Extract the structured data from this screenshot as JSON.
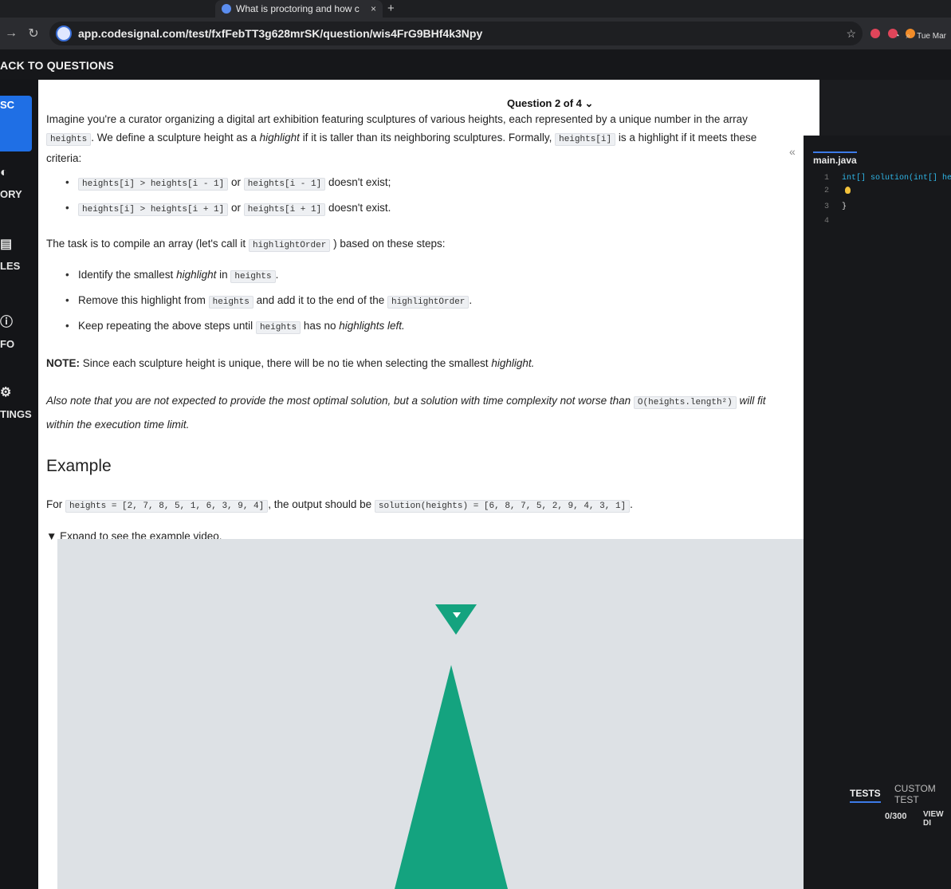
{
  "browser": {
    "tab_title": "What is proctoring and how c",
    "tab_close": "×",
    "new_tab": "+",
    "url": "app.codesignal.com/test/fxfFebTT3g628mrSK/question/wis4FrG9BHf4k3Npy",
    "clock": "Tue Mar"
  },
  "app": {
    "back_label": "ACK TO QUESTIONS",
    "question_nav": "Question 2 of 4 ⌄"
  },
  "sidebar": {
    "items": [
      {
        "label": "SC"
      },
      {
        "label": "ORY"
      },
      {
        "label": "LES"
      },
      {
        "label": "FO"
      },
      {
        "label": "TINGS"
      }
    ]
  },
  "problem": {
    "intro_1": "Imagine you're a curator organizing a digital art exhibition featuring sculptures of various heights, each represented by a unique number in the array",
    "intro_code_1": "heights",
    "intro_2": ". We define a sculpture height as a",
    "intro_italic": "highlight",
    "intro_3": "if it is taller than its neighboring sculptures. Formally,",
    "intro_code_2": "heights[i]",
    "intro_4": "is a highlight if it meets these criteria:",
    "criteria": [
      {
        "a": "heights[i] > heights[i - 1]",
        "or": "or",
        "b": "heights[i - 1]",
        "tail": "doesn't exist;"
      },
      {
        "a": "heights[i] > heights[i + 1]",
        "or": "or",
        "b": "heights[i + 1]",
        "tail": "doesn't exist."
      }
    ],
    "task_1": "The task is to compile an array (let's call it",
    "task_code": "highlightOrder",
    "task_2": ") based on these steps:",
    "steps": [
      {
        "pre": "Identify the smallest",
        "italic": "highlight",
        "mid": "in",
        "code": "heights",
        "post": ".",
        "code2": "",
        "post2": ""
      },
      {
        "pre": "Remove this highlight from",
        "italic": "",
        "mid": "",
        "code": "heights",
        "post": "and add it to the end of the",
        "code2": "highlightOrder",
        "post2": "."
      },
      {
        "pre": "Keep repeating the above steps until",
        "italic": "",
        "mid": "",
        "code": "heights",
        "post": "has no",
        "code2": "",
        "post2": "highlights left."
      }
    ],
    "note_bold": "NOTE:",
    "note_text": "Since each sculpture height is unique, there will be no tie when selecting the smallest",
    "note_italic": "highlight.",
    "also_1": "Also note that you are not expected to provide the most optimal solution, but a solution with time complexity not worse than",
    "also_code": "O(heights.length²)",
    "also_2": "will fit within the execution time limit.",
    "example_title": "Example",
    "example_for": "For",
    "example_input": "heights = [2, 7, 8, 5, 1, 6, 3, 9, 4]",
    "example_mid": ", the output should be",
    "example_output": "solution(heights) = [6, 8, 7, 5, 2, 9, 4, 3, 1]",
    "example_end": ".",
    "expand_label": "▼ Expand to see the example video."
  },
  "editor": {
    "file_tab": "main.java",
    "lines": [
      {
        "n": "1",
        "code": "int[] solution(int[] hei"
      },
      {
        "n": "2",
        "code": ""
      },
      {
        "n": "3",
        "code": "}"
      },
      {
        "n": "4",
        "code": ""
      }
    ],
    "tests_tab": "TESTS",
    "custom_tab": "CUSTOM TEST",
    "score": "0/300",
    "view_diff": "VIEW DI"
  },
  "colors": {
    "accent_blue": "#1f6fe5",
    "video_green": "#14a37f",
    "code_cyan": "#2fb5e6"
  }
}
